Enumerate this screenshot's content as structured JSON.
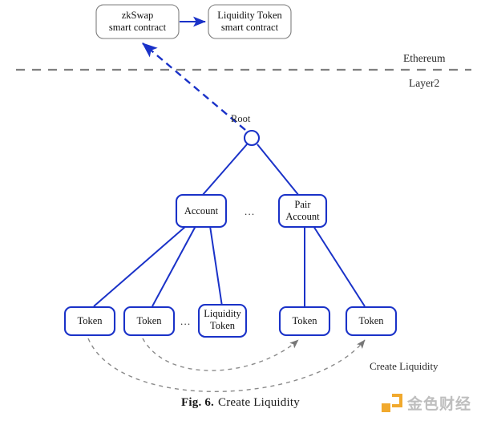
{
  "figure": {
    "caption_number": "Fig. 6.",
    "caption_title": "Create Liquidity"
  },
  "layers": {
    "upper_label": "Ethereum",
    "lower_label": "Layer2",
    "divider_name": "layer-divider-dashed-line"
  },
  "contracts": {
    "zkswap": {
      "line1": "zkSwap",
      "line2": "smart contract"
    },
    "liquidity_token": {
      "line1": "Liquidity Token",
      "line2": "smart contract"
    }
  },
  "tree": {
    "root": {
      "label": "Root"
    },
    "mid": [
      {
        "id": "account",
        "line1": "Account",
        "line2": ""
      },
      {
        "id": "ellipsis-mid",
        "line1": "...",
        "line2": ""
      },
      {
        "id": "pair-account",
        "line1": "Pair",
        "line2": "Account"
      }
    ],
    "leaves": [
      {
        "id": "token-1",
        "line1": "Token",
        "line2": ""
      },
      {
        "id": "token-2",
        "line1": "Token",
        "line2": ""
      },
      {
        "id": "ellipsis-leaf",
        "line1": "...",
        "line2": ""
      },
      {
        "id": "liquidity-token-leaf",
        "line1": "Liquidity",
        "line2": "Token"
      },
      {
        "id": "token-4",
        "line1": "Token",
        "line2": ""
      },
      {
        "id": "token-5",
        "line1": "Token",
        "line2": ""
      }
    ]
  },
  "annotations": {
    "create_liquidity": "Create Liquidity"
  },
  "watermark": {
    "text": "金色财经"
  },
  "colors": {
    "node_blue": "#1a32c8",
    "contract_border": "#808080",
    "dashed_gray": "#808080",
    "brand_orange": "#f0a21c",
    "text": "#111111"
  }
}
